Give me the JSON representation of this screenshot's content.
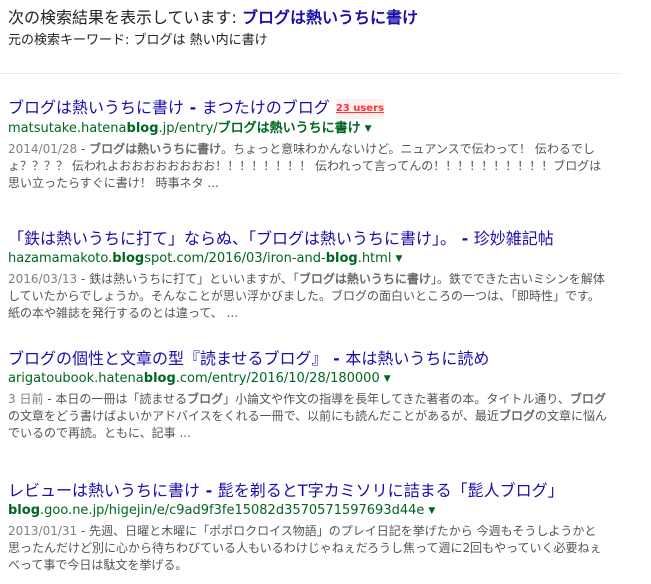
{
  "correction": {
    "prefix": "次の検索結果を表示しています: ",
    "corrected_query": "ブログは熱いうちに書け",
    "original_prefix": "元の検索キーワード: ",
    "original_query": "ブログは 熱い内に書け"
  },
  "results": [
    {
      "title_main": "ブログは熱いうちに書け",
      "title_sep": " - ",
      "title_site": "まつたけのブログ",
      "users_badge": "23 users",
      "url_pre": "matsutake.hatena",
      "url_bold": "blog",
      "url_post": ".jp/entry/",
      "url_bold2": "ブログは熱いうちに書け",
      "date": "2014/01/28",
      "snippet_dash": " - ",
      "snippet_bold": "ブログは熱いうちに書け",
      "snippet_rest": "。ちょっと意味わかんないけど。ニュアンスで伝わって！ 伝わるでしょ？？？？ 伝われよおおおおおおおお！！！！！！！！ 伝われって言ってんの！！！！！！！！！！ブログは思い立ったらすぐに書け！ 時事ネタ ..."
    },
    {
      "title_main": "「鉄は熱いうちに打て」ならぬ、「ブログは熱いうちに書け」。",
      "title_sep": " - ",
      "title_site": "珍妙雑記帖",
      "url_pre": "hazamamakoto.",
      "url_bold": "blog",
      "url_post": "spot.com/2016/03/iron-and-",
      "url_bold2": "blog",
      "url_post2": ".html",
      "date": "2016/03/13",
      "snippet_dash": " - ",
      "snippet_pre": "鉄は熱いうちに打て」といいますが、「",
      "snippet_bold": "ブログは熱いうちに書け",
      "snippet_rest": "」。鉄でできた古いミシンを解体していたからでしょうか。そんなことが思い浮かびました。ブログの面白いところの一つは、「即時性」です。紙の本や雑誌を発行するのとは違って、 ..."
    },
    {
      "title_main": "ブログの個性と文章の型『読ませるブログ』",
      "title_sep": " - ",
      "title_site": "本は熱いうちに読め",
      "url_pre": "arigatoubook.hatena",
      "url_bold": "blog",
      "url_post": ".com/entry/2016/10/28/180000",
      "date": "3 日前",
      "snippet_dash": " - ",
      "snippet_pre": "本日の一冊は「読ませる",
      "snippet_bold": "ブログ",
      "snippet_mid": "」小論文や作文の指導を長年してきた著者の本。タイトル通り、",
      "snippet_bold2": "ブログ",
      "snippet_mid2": "の文章をどう書けばよいかアドバイスをくれる一冊で、以前にも読んだことがあるが、最近",
      "snippet_bold3": "ブログ",
      "snippet_rest": "の文章に悩んでいるので再読。ともに、記事 ..."
    },
    {
      "title_main": "レビューは熱いうちに書け",
      "title_sep": " - ",
      "title_site": "髭を剃るとT字カミソリに詰まる「髭人ブログ」",
      "url_pre": "",
      "url_bold": "blog",
      "url_post": ".goo.ne.jp/higejin/e/c9ad9f3fe15082d3570571597693d44e",
      "date": "2013/01/31",
      "snippet_dash": " - ",
      "snippet_rest": "先週、日曜と木曜に「ポポロクロイス物語」のプレイ日記を挙げたから 今週もそうしようかと思ったんだけど別に心から待ちわびている人もいるわけじゃねぇだろうし焦って週に2回もやっていく必要ねぇべって事で今日は駄文を挙げる。"
    }
  ],
  "caret_glyph": "▼"
}
